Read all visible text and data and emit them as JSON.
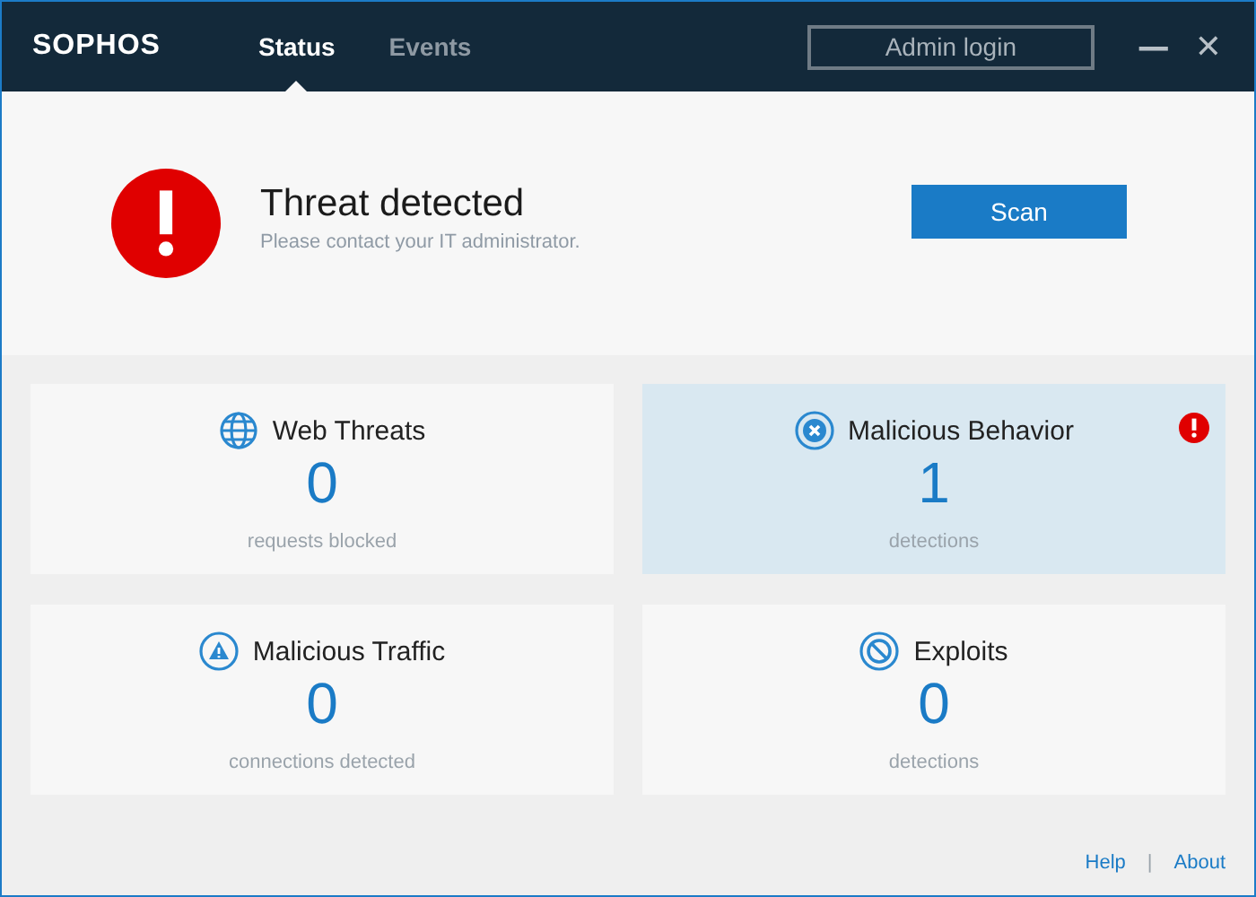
{
  "header": {
    "logo": "SOPHOS",
    "tabs": [
      {
        "label": "Status",
        "selected": true
      },
      {
        "label": "Events",
        "selected": false
      }
    ],
    "admin_button": "Admin login",
    "minimize": "—",
    "close": "✕"
  },
  "status": {
    "title": "Threat detected",
    "message": "Please contact your IT administrator.",
    "button": "Scan"
  },
  "tiles": [
    {
      "kind": "globe",
      "title": "Web Threats",
      "count": "0",
      "caption": "requests blocked",
      "alert": false
    },
    {
      "kind": "cross",
      "title": "Malicious Behavior",
      "count": "1",
      "caption": "detections",
      "alert": true
    },
    {
      "kind": "warning",
      "title": "Malicious Traffic",
      "count": "0",
      "caption": "connections detected",
      "alert": false
    },
    {
      "kind": "block",
      "title": "Exploits",
      "count": "0",
      "caption": "detections",
      "alert": false
    }
  ],
  "footer": {
    "links": [
      "Help",
      "About"
    ],
    "separator": "|"
  }
}
